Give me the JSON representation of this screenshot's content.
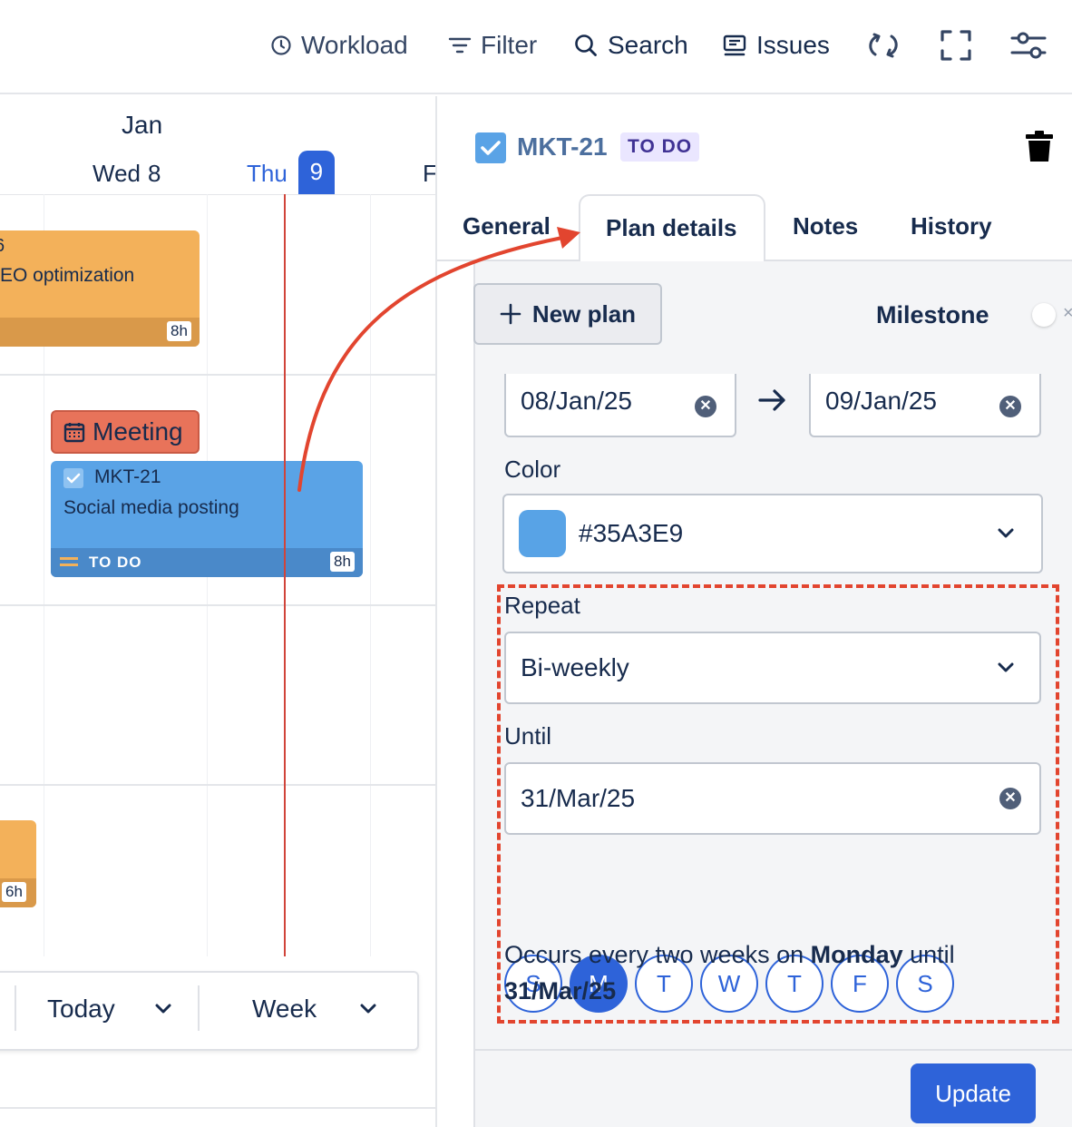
{
  "toolbar": {
    "workload": "Workload",
    "filter": "Filter",
    "search": "Search",
    "issues": "Issues"
  },
  "calendar": {
    "month": "Jan",
    "days": [
      {
        "name": "Wed",
        "num": "8"
      },
      {
        "name": "Thu",
        "num": "9"
      },
      {
        "name": "F",
        "num": ""
      }
    ],
    "cards": [
      {
        "id_partial": "6",
        "title_partial": "EO optimization",
        "hours": "8h",
        "color": "#f3b15a"
      },
      {
        "id": "MKT-21",
        "title": "Social media posting",
        "status": "TO DO",
        "hours": "8h",
        "color": "#5aa3e6"
      },
      {
        "hours": "6h",
        "color": "#f3b15a"
      }
    ],
    "meeting_label": "Meeting",
    "bottom_bar": {
      "today": "Today",
      "week": "Week"
    }
  },
  "panel": {
    "issue_key": "MKT-21",
    "status_badge": "TO DO",
    "tabs": [
      "General",
      "Plan details",
      "Notes",
      "History"
    ],
    "active_tab": "Plan details",
    "new_plan": "New plan",
    "milestone_label": "Milestone",
    "start_date": "08/Jan/25",
    "end_date": "09/Jan/25",
    "color_label": "Color",
    "color_value": "#35A3E9",
    "color_swatch": "#58a3e6",
    "repeat_label": "Repeat",
    "repeat_value": "Bi-weekly",
    "until_label": "Until",
    "until_value": "31/Mar/25",
    "weekdays": [
      "S",
      "M",
      "T",
      "W",
      "T",
      "F",
      "S"
    ],
    "selected_weekday_index": 1,
    "summary_prefix": "Occurs every two weeks on ",
    "summary_day": "Monday",
    "summary_mid": " until",
    "summary_date": "31/Mar/25",
    "update_button": "Update"
  },
  "colors": {
    "accent": "#2e63d9",
    "annotation_red": "#e2452f",
    "meeting": "#e8735a"
  }
}
